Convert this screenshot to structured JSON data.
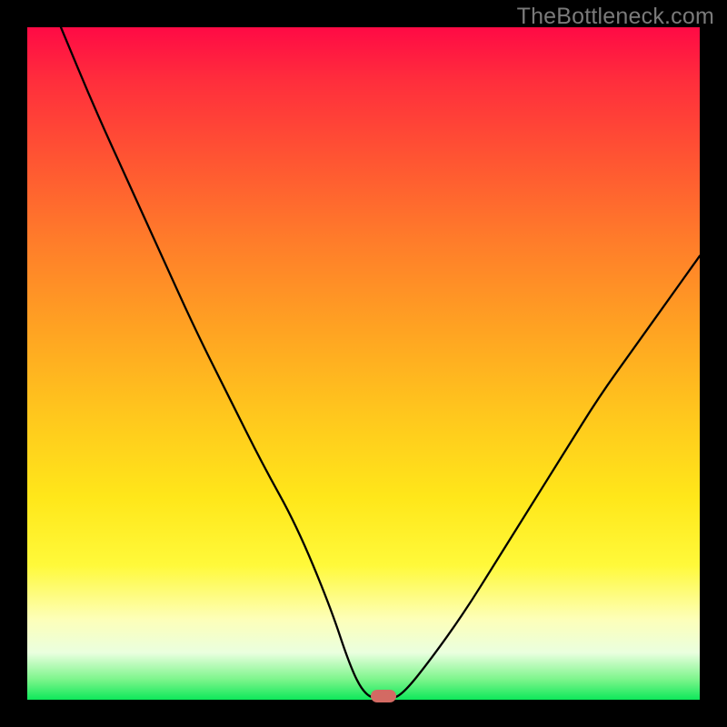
{
  "watermark": "TheBottleneck.com",
  "chart_data": {
    "type": "line",
    "title": "",
    "xlabel": "",
    "ylabel": "",
    "xlim": [
      0,
      100
    ],
    "ylim": [
      0,
      100
    ],
    "grid": false,
    "legend": false,
    "series": [
      {
        "name": "bottleneck-curve",
        "x": [
          5,
          10,
          15,
          20,
          25,
          30,
          35,
          40,
          45,
          48,
          50,
          52,
          54,
          56,
          60,
          65,
          70,
          75,
          80,
          85,
          90,
          95,
          100
        ],
        "values": [
          100,
          88,
          77,
          66,
          55,
          45,
          35,
          26,
          14,
          5,
          1,
          0,
          0,
          1,
          6,
          13,
          21,
          29,
          37,
          45,
          52,
          59,
          66
        ]
      }
    ],
    "optimal_point": {
      "x": 53,
      "y": 0
    },
    "background_gradient": {
      "top_color": "#ff0a45",
      "bottom_color": "#0ee85a",
      "meaning": "severity-heatmap"
    }
  }
}
